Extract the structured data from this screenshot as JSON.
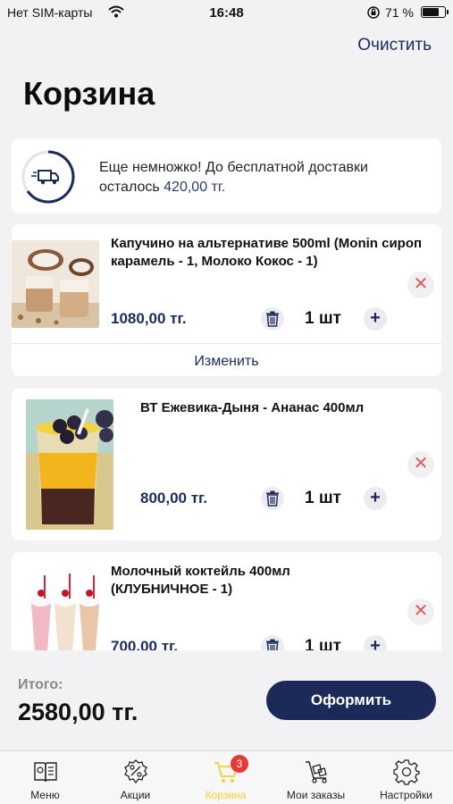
{
  "status_bar": {
    "carrier": "Нет SIM-карты",
    "time": "16:48",
    "battery_pct": "71 %"
  },
  "header": {
    "clear_label": "Очистить",
    "title": "Корзина"
  },
  "delivery": {
    "message": "Еще немножко! До бесплатной доставки осталось",
    "amount": "420,00 тг."
  },
  "items": [
    {
      "name": "Капучино на альтернативе 500ml (Monin сироп карамель - 1, Молоко Кокос - 1)",
      "price": "1080,00 тг.",
      "qty": "1 шт",
      "edit_label": "Изменить"
    },
    {
      "name": "ВТ Ежевика-Дыня - Ананас 400мл",
      "price": "800,00 тг.",
      "qty": "1 шт"
    },
    {
      "name": "Молочный коктейль 400мл (КЛУБНИЧНОЕ  - 1)",
      "price": "700,00 тг.",
      "qty": "1 шт"
    }
  ],
  "checkout": {
    "total_label": "Итого:",
    "total_value": "2580,00 тг.",
    "button_label": "Оформить"
  },
  "tabs": [
    {
      "label": "Меню",
      "icon": "menu-book-icon"
    },
    {
      "label": "Акции",
      "icon": "discount-icon"
    },
    {
      "label": "Корзина",
      "icon": "cart-icon",
      "badge": "3",
      "active": true
    },
    {
      "label": "Мои заказы",
      "icon": "trolley-icon"
    },
    {
      "label": "Настройки",
      "icon": "gear-icon"
    }
  ],
  "colors": {
    "accent": "#1c2a5a",
    "active_tab": "#f2d12e",
    "badge": "#e53935",
    "remove": "#e05a5a"
  }
}
